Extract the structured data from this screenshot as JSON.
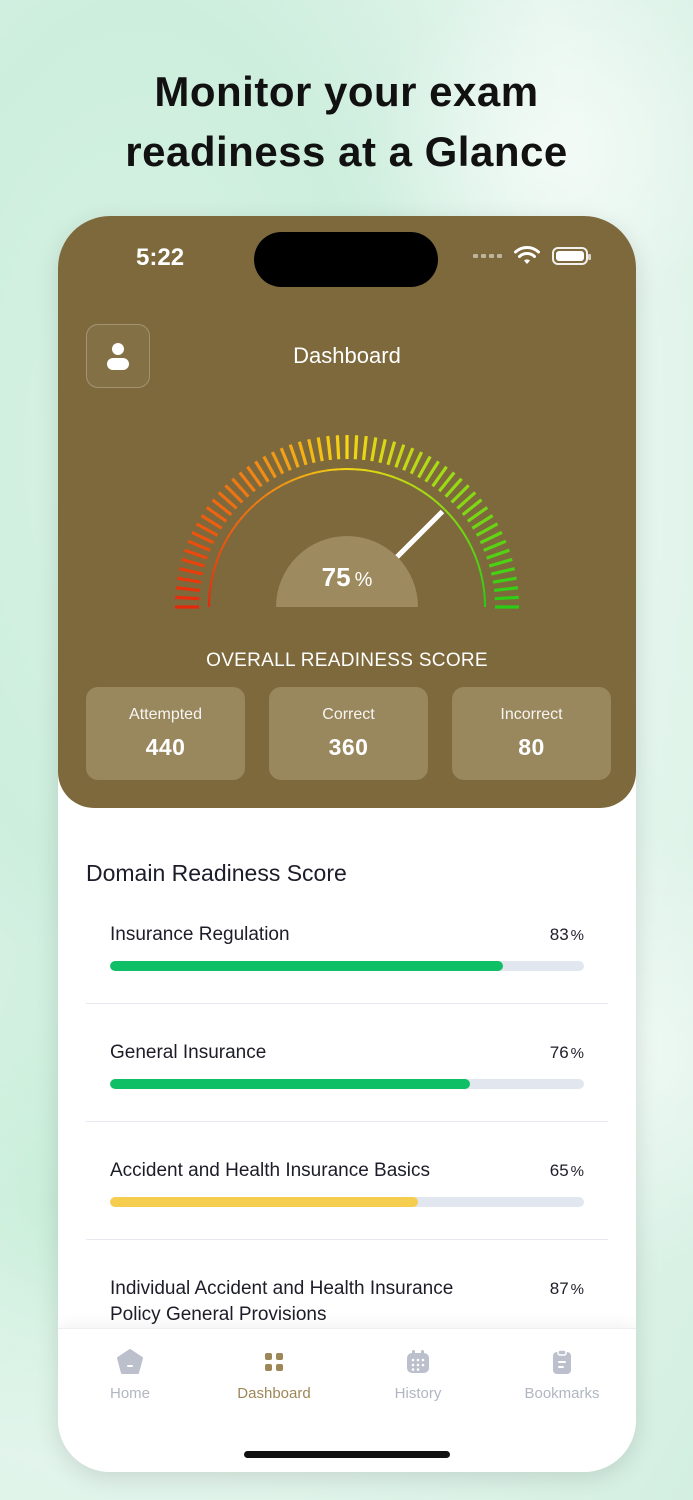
{
  "headline": {
    "line1": "Monitor your exam",
    "line2": "readiness at a Glance"
  },
  "status_bar": {
    "time": "5:22"
  },
  "header": {
    "title": "Dashboard"
  },
  "readiness": {
    "percent_value": "75",
    "percent_sign": "%",
    "score": 0.75,
    "label": "OVERALL READINESS SCORE"
  },
  "stats": [
    {
      "label": "Attempted",
      "value": "440"
    },
    {
      "label": "Correct",
      "value": "360"
    },
    {
      "label": "Incorrect",
      "value": "80"
    }
  ],
  "domain_section": {
    "title": "Domain Readiness Score",
    "items": [
      {
        "name": "Insurance Regulation",
        "percent": "83",
        "sign": "%",
        "level": 0.83,
        "color": "#0fbf66"
      },
      {
        "name": "General Insurance",
        "percent": "76",
        "sign": "%",
        "level": 0.76,
        "color": "#0fbf66"
      },
      {
        "name": "Accident and Health Insurance Basics",
        "percent": "65",
        "sign": "%",
        "level": 0.65,
        "color": "#f5ce4f"
      },
      {
        "name": "Individual Accident and Health Insurance Policy General Provisions",
        "percent": "87",
        "sign": "%",
        "level": 0.87,
        "color": "#0fbf66"
      }
    ]
  },
  "tabs": [
    {
      "label": "Home",
      "icon": "home-icon"
    },
    {
      "label": "Dashboard",
      "icon": "dashboard-icon",
      "active": true
    },
    {
      "label": "History",
      "icon": "history-icon"
    },
    {
      "label": "Bookmarks",
      "icon": "bookmarks-icon"
    }
  ],
  "colors": {
    "hero": "#7d693c",
    "accent": "#9d8757",
    "green": "#0fbf66",
    "yellow": "#f5ce4f"
  }
}
